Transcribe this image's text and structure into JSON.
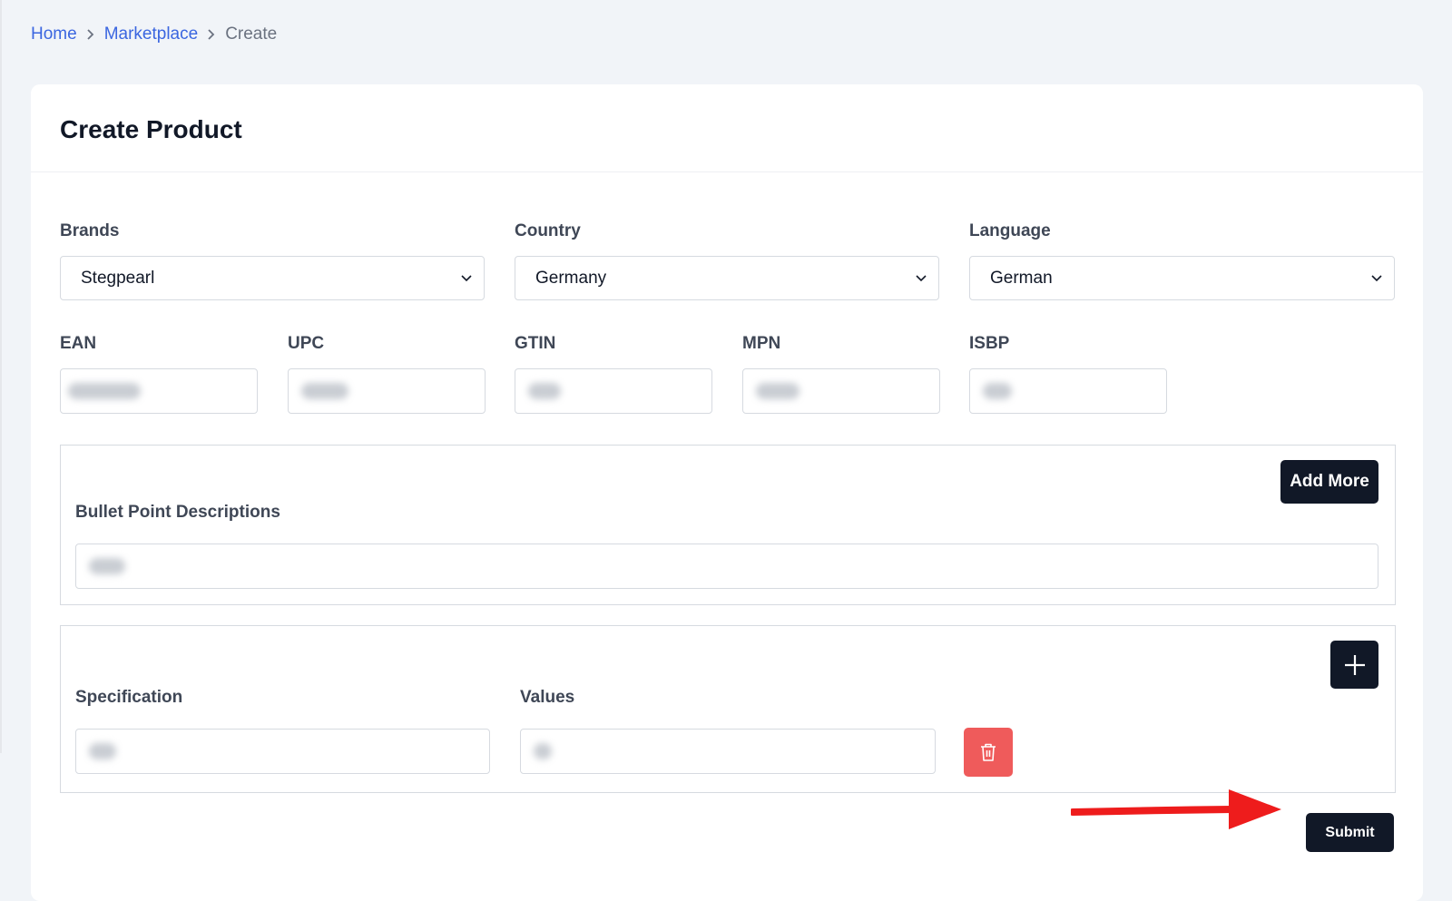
{
  "breadcrumb": {
    "home": "Home",
    "marketplace": "Marketplace",
    "current": "Create"
  },
  "page": {
    "title": "Create Product"
  },
  "form": {
    "brands": {
      "label": "Brands",
      "value": "Stegpearl"
    },
    "country": {
      "label": "Country",
      "value": "Germany"
    },
    "language": {
      "label": "Language",
      "value": "German"
    },
    "ean": {
      "label": "EAN"
    },
    "upc": {
      "label": "UPC"
    },
    "gtin": {
      "label": "GTIN"
    },
    "mpn": {
      "label": "MPN"
    },
    "isbp": {
      "label": "ISBP"
    },
    "bullets": {
      "label": "Bullet Point Descriptions",
      "add_more": "Add More"
    },
    "specification": {
      "label": "Specification"
    },
    "values": {
      "label": "Values"
    },
    "submit": "Submit"
  },
  "colors": {
    "accent_link": "#3b66e0",
    "dark_button": "#111827",
    "danger": "#ef5b5b",
    "annotation_arrow": "#ee1c1c"
  },
  "icons": [
    "chevron-right-icon",
    "chevron-down-icon",
    "plus-icon",
    "trash-icon",
    "red-arrow-annotation"
  ]
}
